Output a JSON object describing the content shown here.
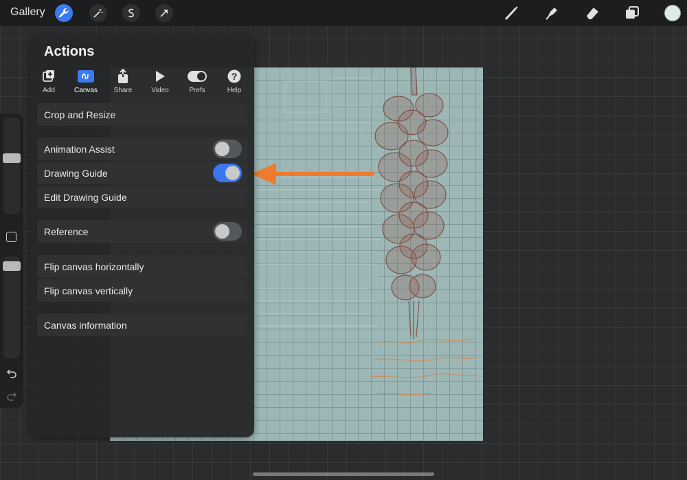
{
  "topbar": {
    "gallery_label": "Gallery",
    "left_tools": [
      "wrench-icon",
      "magic-wand-icon",
      "selection-s-icon",
      "transform-arrow-icon"
    ],
    "right_tools": [
      "brush-icon",
      "smudge-icon",
      "eraser-icon",
      "layers-icon"
    ],
    "current_color": "#dfe9e6",
    "accent_color": "#3b7bf0"
  },
  "panel": {
    "title": "Actions",
    "tabs": [
      {
        "label": "Add",
        "icon": "add-image-icon"
      },
      {
        "label": "Canvas",
        "icon": "canvas-icon",
        "active": true
      },
      {
        "label": "Share",
        "icon": "share-icon"
      },
      {
        "label": "Video",
        "icon": "play-icon"
      },
      {
        "label": "Prefs",
        "icon": "toggle-icon"
      },
      {
        "label": "Help",
        "icon": "help-icon"
      }
    ],
    "items": {
      "crop_resize": "Crop and Resize",
      "animation_assist": {
        "label": "Animation Assist",
        "on": false
      },
      "drawing_guide": {
        "label": "Drawing Guide",
        "on": true
      },
      "edit_drawing_guide": "Edit Drawing Guide",
      "reference": {
        "label": "Reference",
        "on": false
      },
      "flip_h": "Flip canvas horizontally",
      "flip_v": "Flip canvas vertically",
      "canvas_info": "Canvas information"
    }
  },
  "annotation": {
    "arrow_color": "#f07a2e"
  }
}
